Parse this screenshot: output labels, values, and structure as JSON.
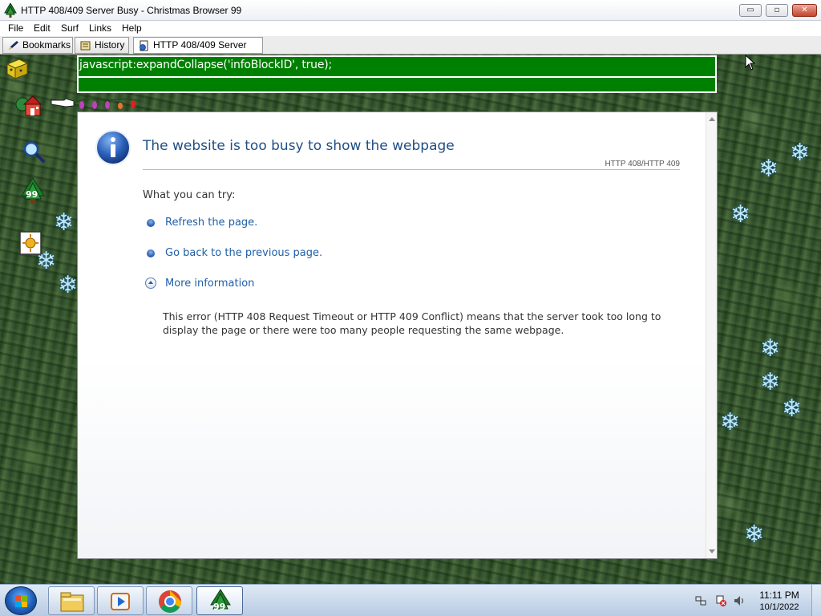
{
  "window": {
    "title": "HTTP 408/409 Server Busy - Christmas Browser 99",
    "controls": {
      "minimize": "▭",
      "maximize": "▫",
      "close": "✕"
    }
  },
  "menubar": {
    "items": [
      "File",
      "Edit",
      "Surf",
      "Links",
      "Help"
    ]
  },
  "tabs": [
    {
      "label": "Bookmarks",
      "icon": "pen-icon"
    },
    {
      "label": "History",
      "icon": "scroll-icon"
    },
    {
      "label": "HTTP 408/409 Server Busy",
      "icon": "page-icon"
    }
  ],
  "address": {
    "value": "javascript:expandCollapse('infoBlockID', true);"
  },
  "toolbar_left": {
    "badge_99": "99",
    "icons": [
      "gift-box-icon",
      "home-icon",
      "magnifier-icon",
      "christmas-tree-99-icon",
      "sun-frame-icon"
    ]
  },
  "error_page": {
    "title": "The website is too busy to show the webpage",
    "code": "HTTP 408/HTTP 409",
    "try_label": "What you can try:",
    "refresh_link": "Refresh the page.",
    "back_link": "Go back to the previous page.",
    "more_info": "More information",
    "description": "This error (HTTP 408 Request Timeout or HTTP 409 Conflict) means that the server took too long to display the page or there were too many people requesting the same webpage."
  },
  "taskbar": {
    "items": [
      "start-orb",
      "file-explorer",
      "media-player",
      "chrome",
      "christmas-browser-99"
    ],
    "active_badge": "99",
    "clock_time": "11:11 PM",
    "clock_date": "10/1/2022"
  },
  "colors": {
    "address_bg": "#008000",
    "title_text": "#1f4e86",
    "link": "#1f5fa8",
    "snowflake": "#bfe8ff"
  }
}
